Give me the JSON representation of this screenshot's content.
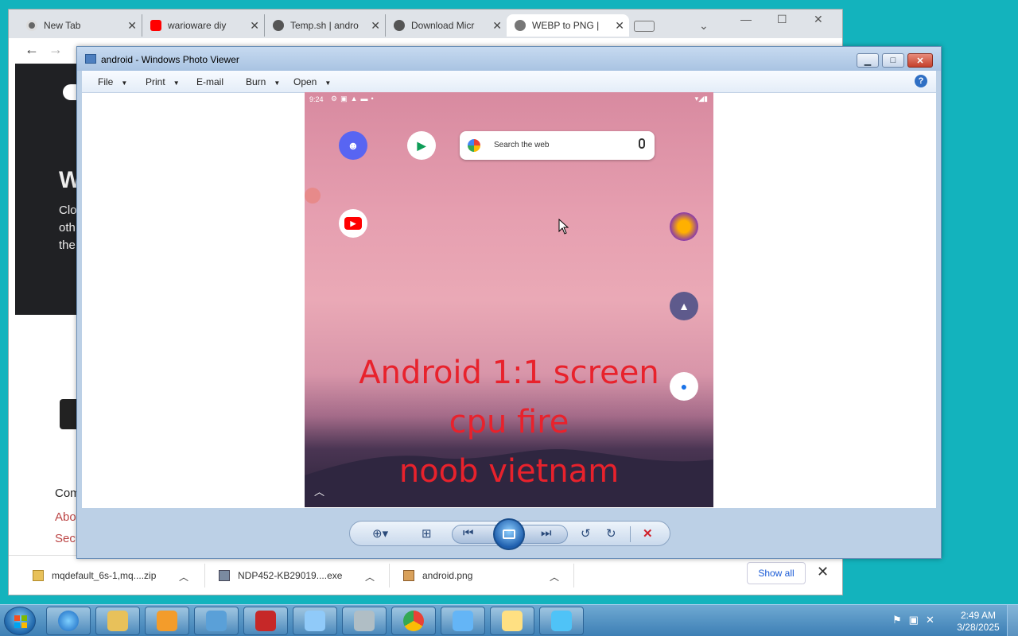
{
  "browser": {
    "tabs": [
      {
        "label": "New Tab"
      },
      {
        "label": "warioware diy"
      },
      {
        "label": "Temp.sh | andro"
      },
      {
        "label": "Download Micr"
      },
      {
        "label": "WEBP to PNG |"
      }
    ],
    "content": {
      "heading_initial": "W",
      "para_lines": [
        "Clo",
        "oth",
        "the"
      ],
      "footer_heading": "Com",
      "footer_links": [
        "Abo",
        "Secu"
      ]
    },
    "downloads": {
      "items": [
        {
          "name": "mqdefault_6s-1,mq....zip"
        },
        {
          "name": "NDP452-KB29019....exe"
        },
        {
          "name": "android.png"
        }
      ],
      "show_all_label": "Show all"
    }
  },
  "photo_viewer": {
    "title": "android - Windows Photo Viewer",
    "menu": [
      {
        "label": "File"
      },
      {
        "label": "Print"
      },
      {
        "label": "E-mail"
      },
      {
        "label": "Burn"
      },
      {
        "label": "Open"
      }
    ],
    "help_icon": "?"
  },
  "android_image": {
    "status_time": "9:24",
    "search_placeholder": "Search the web",
    "overlay_lines": [
      "Android 1:1 screen",
      "cpu fire",
      "noob vietnam"
    ],
    "apps": [
      "discord-icon",
      "play-games-icon",
      "youtube-icon",
      "firefox-icon",
      "astro-icon",
      "messages-icon"
    ]
  },
  "taskbar": {
    "time": "2:49 AM",
    "date": "3/28/2025"
  },
  "colors": {
    "desktop": "#13b3bd",
    "overlay_text": "#e8222c",
    "discord": "#5865f2",
    "youtube": "#ff0000"
  }
}
